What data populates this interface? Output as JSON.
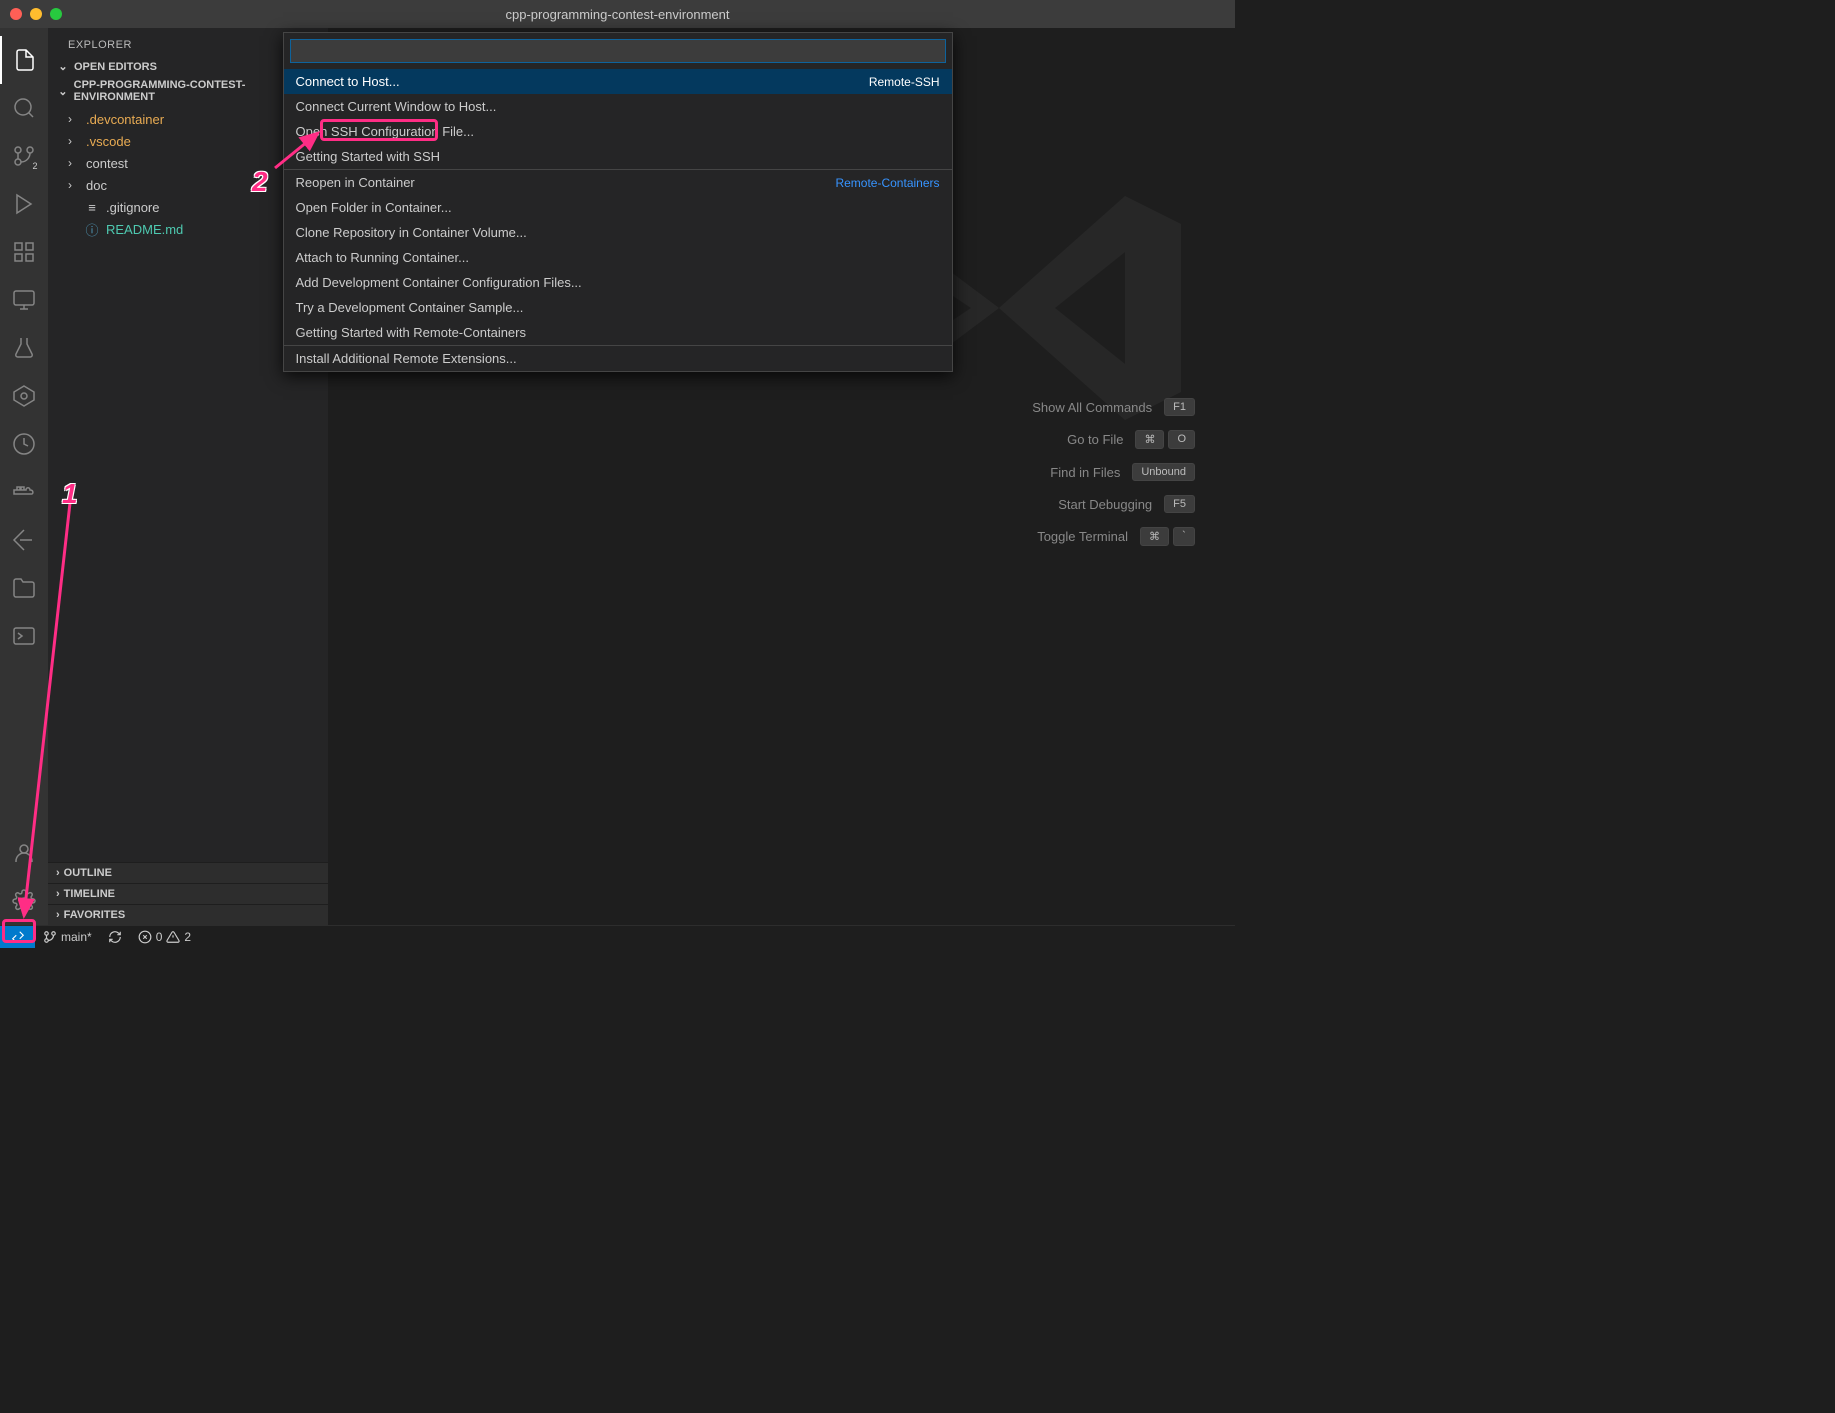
{
  "window": {
    "title": "cpp-programming-contest-environment"
  },
  "sidebar": {
    "title": "EXPLORER",
    "sections": {
      "openEditors": "OPEN EDITORS",
      "project": "CPP-PROGRAMMING-CONTEST-ENVIRONMENT",
      "outline": "OUTLINE",
      "timeline": "TIMELINE",
      "favorites": "FAVORITES"
    },
    "tree": [
      {
        "label": ".devcontainer",
        "type": "folder"
      },
      {
        "label": ".vscode",
        "type": "folder"
      },
      {
        "label": "contest",
        "type": "folder-neutral"
      },
      {
        "label": "doc",
        "type": "folder-neutral"
      },
      {
        "label": ".gitignore",
        "type": "file"
      },
      {
        "label": "README.md",
        "type": "readme"
      }
    ]
  },
  "activityBadgeSCM": "2",
  "palette": {
    "placeholder": "",
    "items": [
      {
        "label": "Connect to Host...",
        "category": "Remote-SSH",
        "selected": true
      },
      {
        "label": "Connect Current Window to Host...",
        "category": ""
      },
      {
        "label": "Open SSH Configuration File...",
        "category": ""
      },
      {
        "label": "Getting Started with SSH",
        "category": ""
      },
      {
        "label": "Reopen in Container",
        "category": "Remote-Containers",
        "divider": true
      },
      {
        "label": "Open Folder in Container...",
        "category": ""
      },
      {
        "label": "Clone Repository in Container Volume...",
        "category": ""
      },
      {
        "label": "Attach to Running Container...",
        "category": ""
      },
      {
        "label": "Add Development Container Configuration Files...",
        "category": ""
      },
      {
        "label": "Try a Development Container Sample...",
        "category": ""
      },
      {
        "label": "Getting Started with Remote-Containers",
        "category": ""
      },
      {
        "label": "Install Additional Remote Extensions...",
        "category": "",
        "divider": true
      }
    ]
  },
  "shortcuts": [
    {
      "label": "Show All Commands",
      "keys": [
        "F1"
      ]
    },
    {
      "label": "Go to File",
      "keys": [
        "⌘",
        "O"
      ]
    },
    {
      "label": "Find in Files",
      "keys": [
        "Unbound"
      ]
    },
    {
      "label": "Start Debugging",
      "keys": [
        "F5"
      ]
    },
    {
      "label": "Toggle Terminal",
      "keys": [
        "⌘",
        "`"
      ]
    }
  ],
  "statusBar": {
    "branch": "main*",
    "errors": "0",
    "warnings": "2"
  },
  "annotations": {
    "num1": "1",
    "num2": "2"
  }
}
